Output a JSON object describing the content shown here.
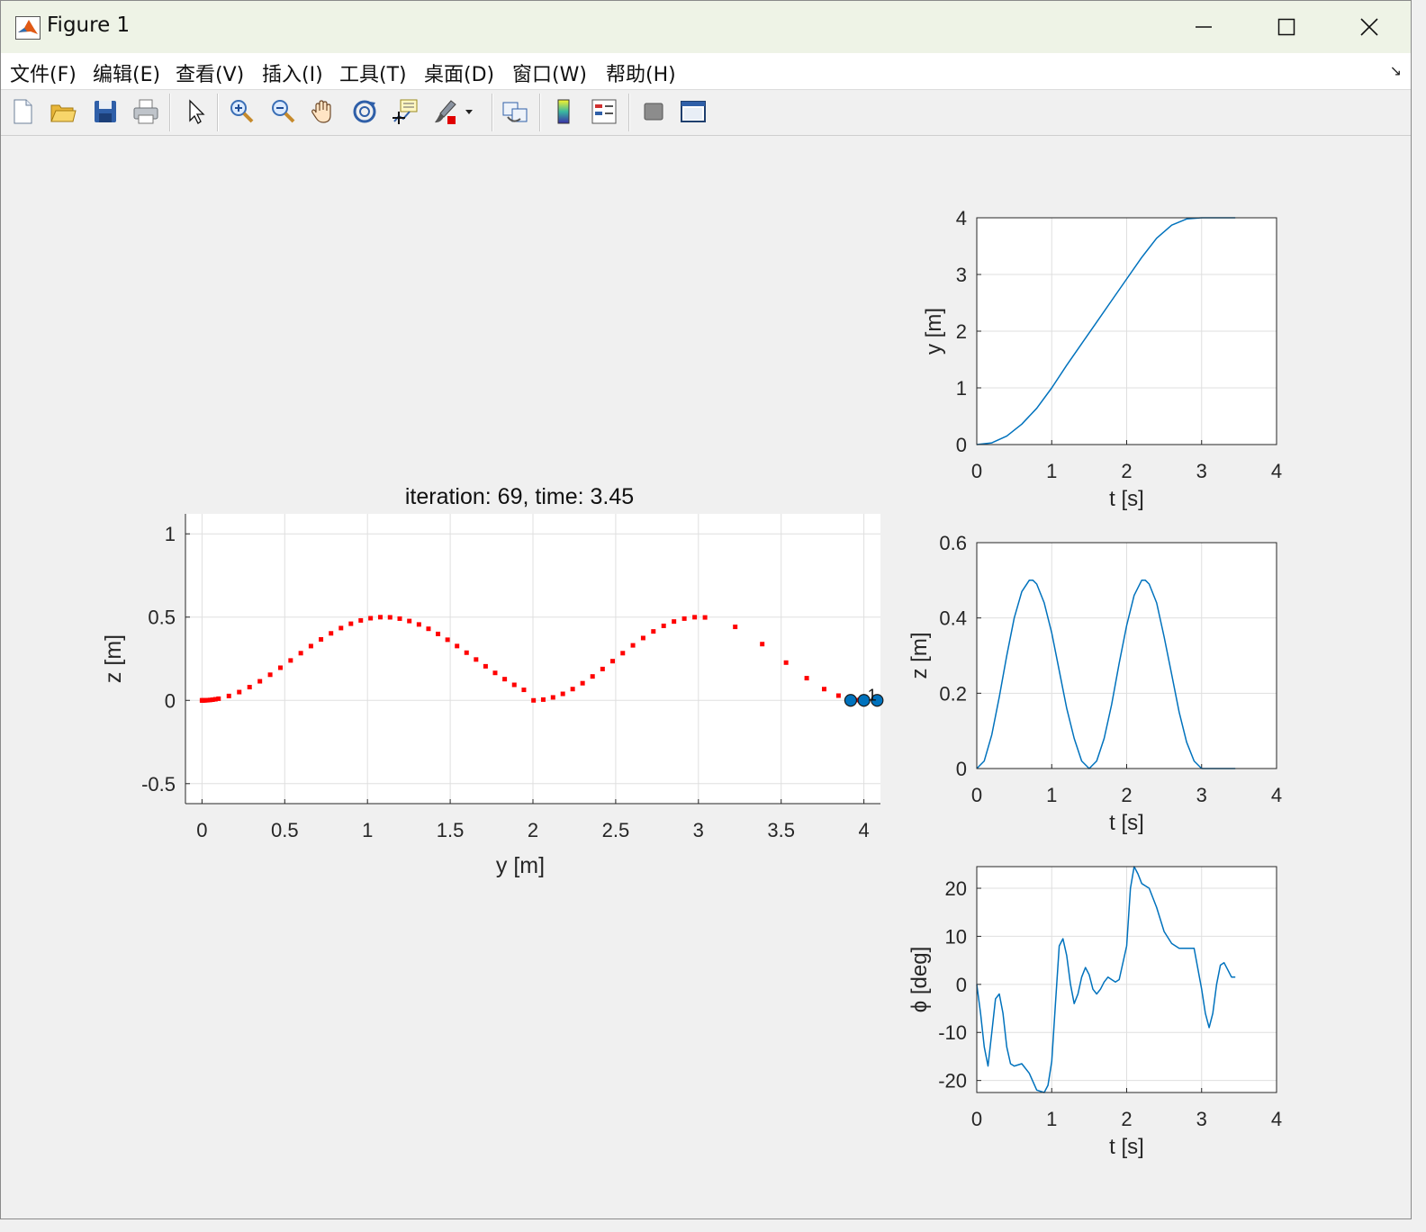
{
  "window": {
    "title": "Figure 1",
    "controls": [
      "minimize",
      "maximize",
      "close"
    ]
  },
  "menu": [
    {
      "label": "文件(F)"
    },
    {
      "label": "编辑(E)"
    },
    {
      "label": "查看(V)"
    },
    {
      "label": "插入(I)"
    },
    {
      "label": "工具(T)"
    },
    {
      "label": "桌面(D)"
    },
    {
      "label": "窗口(W)"
    },
    {
      "label": "帮助(H)"
    }
  ],
  "toolbar": [
    "new-figure-icon",
    "open-file-icon",
    "save-icon",
    "print-icon",
    "pointer-icon",
    "zoom-in-icon",
    "zoom-out-icon",
    "pan-hand-icon",
    "rotate-3d-icon",
    "data-cursor-icon",
    "brush-icon",
    "link-plot-icon",
    "colorbar-icon",
    "legend-icon",
    "hide-plot-tools-icon",
    "show-plot-tools-icon"
  ],
  "chart_data": [
    {
      "type": "scatter",
      "title": "iteration: 69, time: 3.45",
      "xlabel": "y [m]",
      "ylabel": "z [m]",
      "xlim": [
        -0.1,
        4.1
      ],
      "ylim": [
        -0.62,
        1.12
      ],
      "xticks": [
        "0",
        "0.5",
        "1",
        "1.5",
        "2",
        "2.5",
        "3",
        "3.5",
        "4"
      ],
      "yticks": [
        "-0.5",
        "0",
        "0.5",
        "1"
      ],
      "grid": true,
      "series": [
        {
          "color": "#ff0000",
          "marker": "square"
        },
        {
          "color": "#0072bd",
          "marker": "circle",
          "x": [
            3.92,
            4.0,
            4.08
          ],
          "y": [
            0,
            0,
            0
          ]
        }
      ],
      "annotations": [
        {
          "text": "1",
          "x": 4.05,
          "y": 0.02
        }
      ]
    },
    {
      "type": "line",
      "xlabel": "t [s]",
      "ylabel": "y [m]",
      "xlim": [
        0,
        4
      ],
      "ylim": [
        0,
        4
      ],
      "xticks": [
        "0",
        "1",
        "2",
        "3",
        "4"
      ],
      "yticks": [
        "0",
        "1",
        "2",
        "3",
        "4"
      ],
      "grid": true,
      "color": "#0072bd",
      "x": [
        0,
        0.2,
        0.4,
        0.6,
        0.8,
        1.0,
        1.2,
        1.4,
        1.6,
        1.8,
        2.0,
        2.2,
        2.4,
        2.6,
        2.8,
        3.0,
        3.2,
        3.45
      ],
      "y": [
        0,
        0.03,
        0.15,
        0.36,
        0.64,
        1.0,
        1.4,
        1.78,
        2.16,
        2.54,
        2.92,
        3.3,
        3.64,
        3.87,
        3.98,
        4.0,
        4.0,
        4.0
      ]
    },
    {
      "type": "line",
      "xlabel": "t [s]",
      "ylabel": "z [m]",
      "xlim": [
        0,
        4
      ],
      "ylim": [
        0,
        0.6
      ],
      "xticks": [
        "0",
        "1",
        "2",
        "3",
        "4"
      ],
      "yticks": [
        "0",
        "0.2",
        "0.4",
        "0.6"
      ],
      "grid": true,
      "color": "#0072bd",
      "x": [
        0,
        0.1,
        0.2,
        0.3,
        0.4,
        0.5,
        0.6,
        0.7,
        0.75,
        0.8,
        0.9,
        1.0,
        1.1,
        1.2,
        1.3,
        1.4,
        1.5,
        1.6,
        1.7,
        1.8,
        1.9,
        2.0,
        2.1,
        2.2,
        2.25,
        2.3,
        2.4,
        2.5,
        2.6,
        2.7,
        2.8,
        2.9,
        3.0,
        3.1,
        3.2,
        3.3,
        3.45
      ],
      "y": [
        0,
        0.02,
        0.09,
        0.19,
        0.3,
        0.4,
        0.47,
        0.5,
        0.5,
        0.49,
        0.44,
        0.36,
        0.26,
        0.16,
        0.08,
        0.02,
        0,
        0.02,
        0.08,
        0.17,
        0.28,
        0.38,
        0.46,
        0.5,
        0.5,
        0.49,
        0.44,
        0.35,
        0.25,
        0.15,
        0.07,
        0.02,
        0,
        0,
        0,
        0,
        0
      ]
    },
    {
      "type": "line",
      "xlabel": "t [s]",
      "ylabel": "ϕ [deg]",
      "xlim": [
        0,
        4
      ],
      "ylim": [
        -22.5,
        24.5
      ],
      "xticks": [
        "0",
        "1",
        "2",
        "3",
        "4"
      ],
      "yticks": [
        "-20",
        "-10",
        "0",
        "10",
        "20"
      ],
      "grid": true,
      "color": "#0072bd",
      "x": [
        0,
        0.05,
        0.1,
        0.15,
        0.2,
        0.25,
        0.3,
        0.35,
        0.4,
        0.45,
        0.5,
        0.6,
        0.7,
        0.8,
        0.9,
        0.95,
        1.0,
        1.05,
        1.1,
        1.15,
        1.2,
        1.25,
        1.3,
        1.35,
        1.4,
        1.45,
        1.5,
        1.55,
        1.6,
        1.65,
        1.7,
        1.75,
        1.8,
        1.85,
        1.9,
        2.0,
        2.05,
        2.1,
        2.15,
        2.2,
        2.25,
        2.3,
        2.4,
        2.5,
        2.6,
        2.7,
        2.8,
        2.9,
        3.0,
        3.05,
        3.1,
        3.15,
        3.2,
        3.25,
        3.3,
        3.35,
        3.4,
        3.45
      ],
      "y": [
        0,
        -6,
        -13,
        -17,
        -10,
        -3,
        -2,
        -6,
        -13,
        -16.5,
        -17,
        -16.5,
        -18.5,
        -22,
        -22.5,
        -21,
        -16,
        -4,
        8,
        9.5,
        6,
        0,
        -4,
        -2,
        1.5,
        3.5,
        2,
        -1,
        -2,
        -1,
        0.5,
        1.5,
        1,
        0.5,
        1,
        8,
        20,
        24.5,
        23,
        21,
        20.5,
        20,
        16,
        11,
        8.5,
        7.5,
        7.5,
        7.5,
        -1,
        -6,
        -9,
        -6,
        0,
        4,
        4.5,
        3,
        1.5,
        1.5
      ]
    }
  ]
}
